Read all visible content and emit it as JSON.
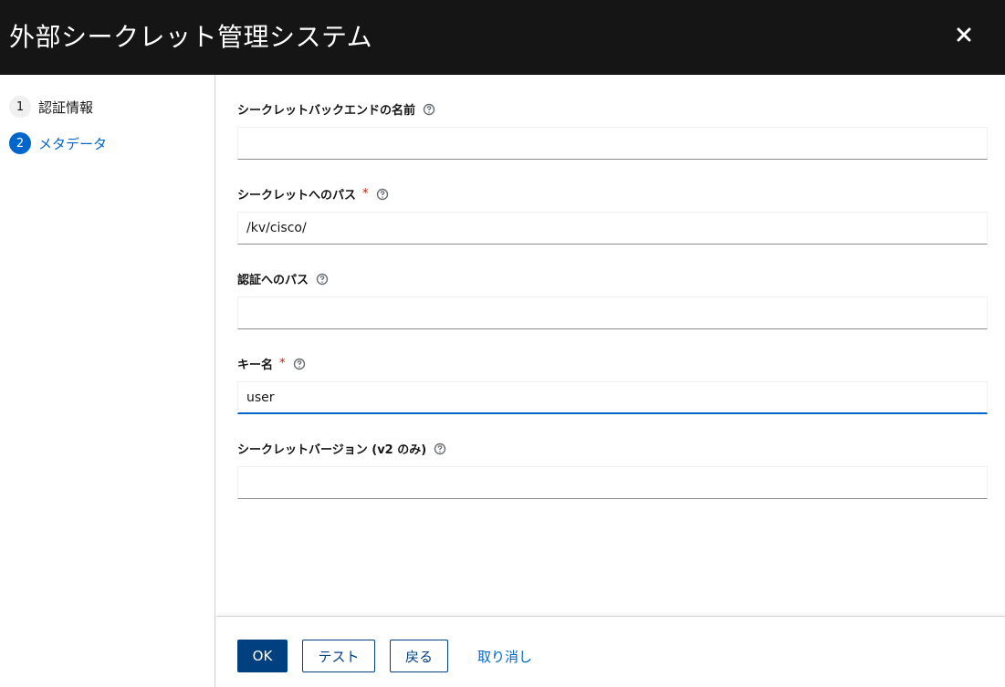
{
  "header": {
    "title": "外部シークレット管理システム",
    "close_icon": "close-icon"
  },
  "wizard": {
    "steps": [
      {
        "number": "1",
        "label": "認証情報",
        "state": "done"
      },
      {
        "number": "2",
        "label": "メタデータ",
        "state": "active"
      }
    ]
  },
  "form": {
    "fields": [
      {
        "label": "シークレットバックエンドの名前",
        "required": false,
        "value": "",
        "placeholder": ""
      },
      {
        "label": "シークレットへのパス",
        "required": true,
        "value": "/kv/cisco/",
        "placeholder": ""
      },
      {
        "label": "認証へのパス",
        "required": false,
        "value": "",
        "placeholder": ""
      },
      {
        "label": "キー名",
        "required": true,
        "value": "user",
        "placeholder": ""
      },
      {
        "label": "シークレットバージョン (v2 のみ)",
        "required": false,
        "value": "",
        "placeholder": ""
      }
    ],
    "required_mark": "*",
    "help_icon": "question-circle-icon"
  },
  "footer": {
    "ok_label": "OK",
    "test_label": "テスト",
    "back_label": "戻る",
    "cancel_label": "取り消し"
  },
  "colors": {
    "header_bg": "#151515",
    "primary": "#004080",
    "link": "#0066cc",
    "required": "#c9190b"
  }
}
